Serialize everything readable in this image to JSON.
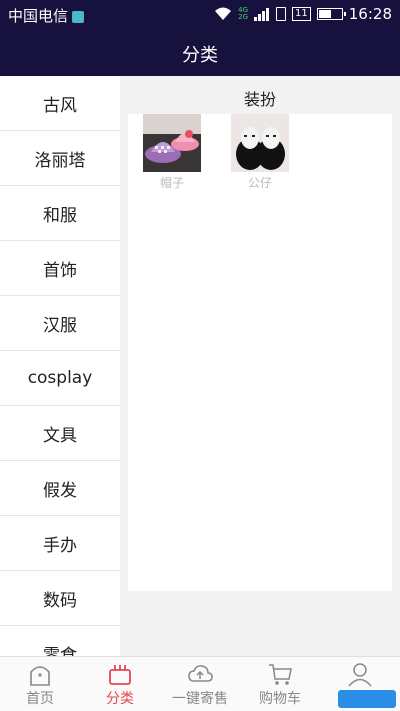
{
  "status": {
    "carrier": "中国电信",
    "net_top": "4G",
    "net_bottom": "2G",
    "battery": "11",
    "time": "16:28"
  },
  "header": {
    "title": "分类"
  },
  "sidebar": {
    "items": [
      {
        "label": "古风"
      },
      {
        "label": "洛丽塔"
      },
      {
        "label": "和服"
      },
      {
        "label": "首饰"
      },
      {
        "label": "汉服"
      },
      {
        "label": "cosplay"
      },
      {
        "label": "文具"
      },
      {
        "label": "假发"
      },
      {
        "label": "手办"
      },
      {
        "label": "数码"
      },
      {
        "label": "零食"
      }
    ]
  },
  "main": {
    "section_title": "装扮",
    "products": [
      {
        "label": "帽子",
        "icon": "hat-image"
      },
      {
        "label": "公仔",
        "icon": "doll-image"
      }
    ]
  },
  "bottom_nav": {
    "items": [
      {
        "label": "首页",
        "icon": "home-icon"
      },
      {
        "label": "分类",
        "icon": "category-bag-icon",
        "active": true
      },
      {
        "label": "一键寄售",
        "icon": "cloud-upload-icon"
      },
      {
        "label": "购物车",
        "icon": "cart-icon"
      },
      {
        "label": "",
        "icon": "user-icon"
      }
    ]
  },
  "colors": {
    "header_bg": "#16123d",
    "active": "#e5484d",
    "inactive": "#888888"
  }
}
